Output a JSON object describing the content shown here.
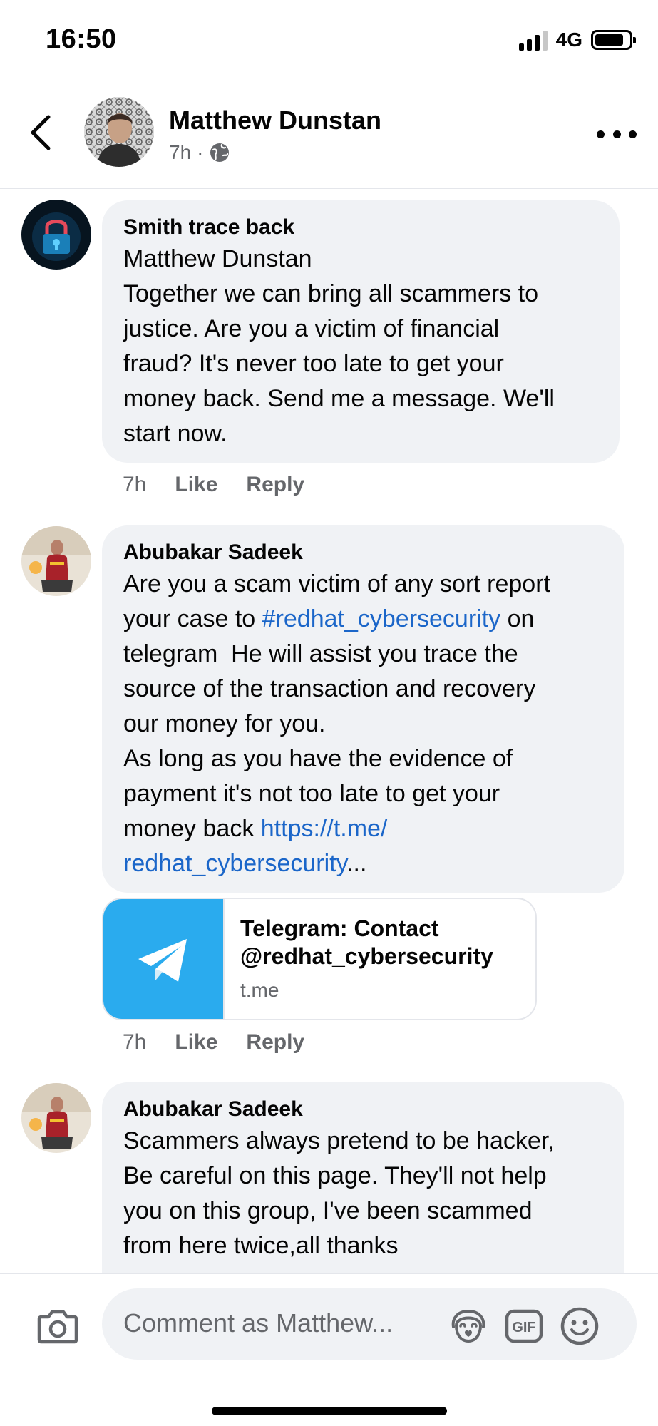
{
  "status_bar": {
    "time": "16:50",
    "network": "4G",
    "signal_bars": 4,
    "signal_active": 3,
    "battery_level": 0.85
  },
  "header": {
    "name": "Matthew Dunstan",
    "time_ago": "7h",
    "separator": "·",
    "audience_icon": "globe-icon"
  },
  "comments": [
    {
      "author": "Smith trace back",
      "lines": [
        "Matthew Dunstan",
        "Together we can bring all scammers to",
        "justice. Are you a victim of financial",
        "fraud? It's never too late to get your",
        "money back. Send me a message. We'll",
        "start now."
      ],
      "time_ago": "7h",
      "like_label": "Like",
      "reply_label": "Reply"
    },
    {
      "author": "Abubakar Sadeek",
      "line1": "Are you a scam victim of any sort report",
      "line2_pre": "your case to ",
      "hashtag": "#redhat_cybersecurity",
      "line2_post": " on",
      "line3": "telegram  He will assist you trace the",
      "line4": "source of the transaction and recovery",
      "line5": "our money for you.",
      "line6": "As long as you have the evidence of",
      "line7": "payment it's not too late to get your",
      "line8_pre": "money back ",
      "link_part1": "https://t.me/",
      "link_part2": "redhat_cybersecurity",
      "ellipsis": "...",
      "time_ago": "7h",
      "like_label": "Like",
      "reply_label": "Reply",
      "link_preview": {
        "title_line1": "Telegram: Contact",
        "title_line2": "@redhat_cybersecurity",
        "domain": "t.me",
        "icon": "telegram-plane-icon"
      }
    },
    {
      "author": "Abubakar Sadeek",
      "lines": [
        "Scammers always pretend to be hacker,",
        "Be careful on this page. They'll not help",
        "you on this group, I've been scammed",
        "from here twice,all thanks"
      ]
    }
  ],
  "composer": {
    "placeholder": "Comment as Matthew...",
    "icons": [
      "camera-icon",
      "avatar-sticker-icon",
      "gif-icon",
      "emoji-icon"
    ]
  },
  "colors": {
    "link": "#1b66c9",
    "bubble": "#f0f2f5",
    "secondary_text": "#65676b",
    "telegram_blue": "#2aabee"
  }
}
